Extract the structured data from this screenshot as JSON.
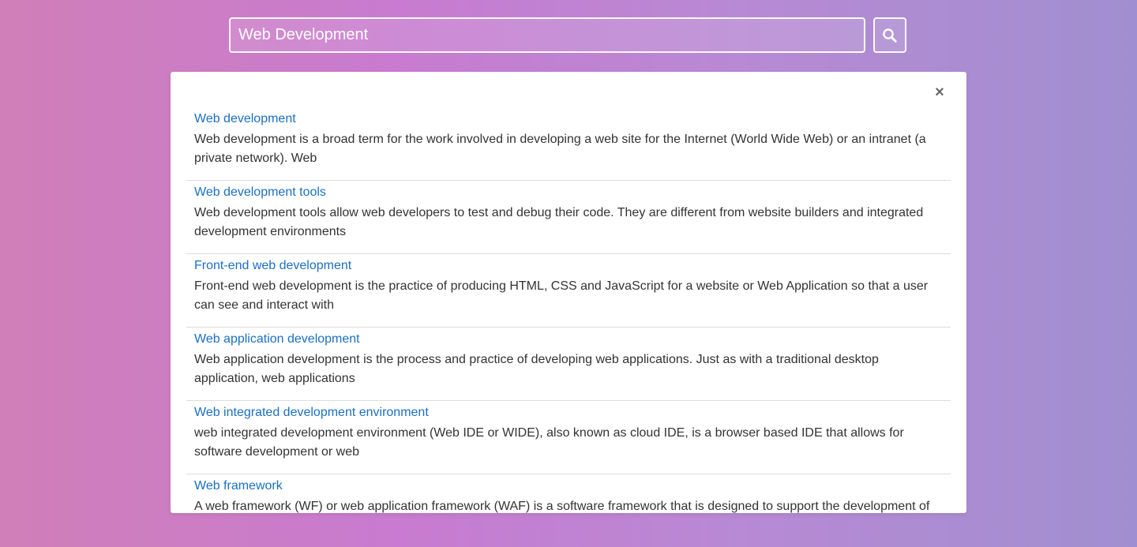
{
  "search": {
    "value": "Web Development",
    "button_icon": "search-icon"
  },
  "panel": {
    "close_label": "×",
    "results": [
      {
        "title": "Web development",
        "snippet": "Web development is a broad term for the work involved in developing a web site for the Internet (World Wide Web) or an intranet (a private network). Web"
      },
      {
        "title": "Web development tools",
        "snippet": "Web development tools allow web developers to test and debug their code. They are different from website builders and integrated development environments"
      },
      {
        "title": "Front-end web development",
        "snippet": "Front-end web development is the practice of producing HTML, CSS and JavaScript for a website or Web Application so that a user can see and interact with"
      },
      {
        "title": "Web application development",
        "snippet": "Web application development is the process and practice of developing web applications. Just as with a traditional desktop application, web applications"
      },
      {
        "title": "Web integrated development environment",
        "snippet": "web integrated development environment (Web IDE or WIDE), also known as cloud IDE, is a browser based IDE that allows for software development or web"
      },
      {
        "title": "Web framework",
        "snippet": "A web framework (WF) or web application framework (WAF) is a software framework that is designed to support the development of"
      }
    ]
  },
  "colors": {
    "link": "#1a6fc4",
    "text": "#333333",
    "divider": "#dddddd",
    "close": "#666666"
  }
}
